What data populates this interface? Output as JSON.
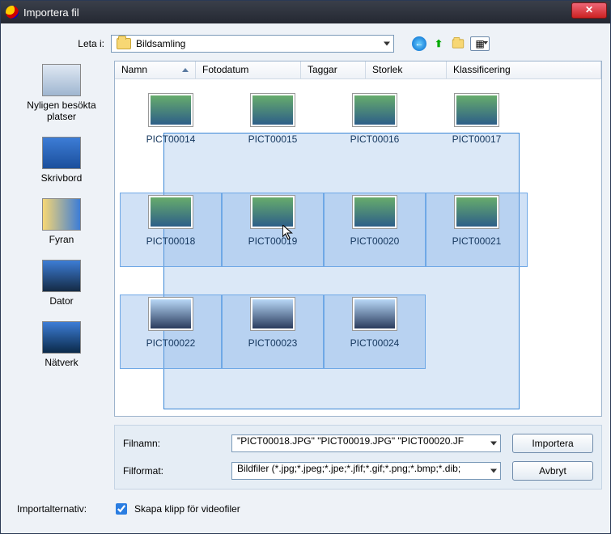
{
  "window": {
    "title": "Importera fil"
  },
  "toprow": {
    "lookin_label": "Leta i:",
    "folder": "Bildsamling"
  },
  "nav_icons": {
    "back": "back-icon",
    "up": "up-icon",
    "newfolder": "new-folder-icon",
    "views": "views-icon"
  },
  "sidebar": {
    "items": [
      {
        "label": "Nyligen besökta platser"
      },
      {
        "label": "Skrivbord"
      },
      {
        "label": "Fyran"
      },
      {
        "label": "Dator"
      },
      {
        "label": "Nätverk"
      }
    ]
  },
  "columns": [
    "Namn",
    "Fotodatum",
    "Taggar",
    "Storlek",
    "Klassificering"
  ],
  "files": {
    "row1": [
      {
        "name": "PICT00014",
        "selected": false
      },
      {
        "name": "PICT00015",
        "selected": false
      },
      {
        "name": "PICT00016",
        "selected": false
      },
      {
        "name": "PICT00017",
        "selected": false
      }
    ],
    "row2": [
      {
        "name": "PICT00018",
        "selected": true
      },
      {
        "name": "PICT00019",
        "selected": true
      },
      {
        "name": "PICT00020",
        "selected": true
      },
      {
        "name": "PICT00021",
        "selected": true
      }
    ],
    "row3": [
      {
        "name": "PICT00022",
        "selected": true
      },
      {
        "name": "PICT00023",
        "selected": true
      },
      {
        "name": "PICT00024",
        "selected": true
      }
    ]
  },
  "form": {
    "filename_label": "Filnamn:",
    "filename_value": "\"PICT00018.JPG\" \"PICT00019.JPG\" \"PICT00020.JF",
    "format_label": "Filformat:",
    "format_value": "Bildfiler (*.jpg;*.jpeg;*.jpe;*.jfif;*.gif;*.png;*.bmp;*.dib;",
    "import_btn": "Importera",
    "cancel_btn": "Avbryt"
  },
  "options": {
    "label": "Importalternativ:",
    "checkbox_label": "Skapa klipp för videofiler",
    "checked": true
  }
}
